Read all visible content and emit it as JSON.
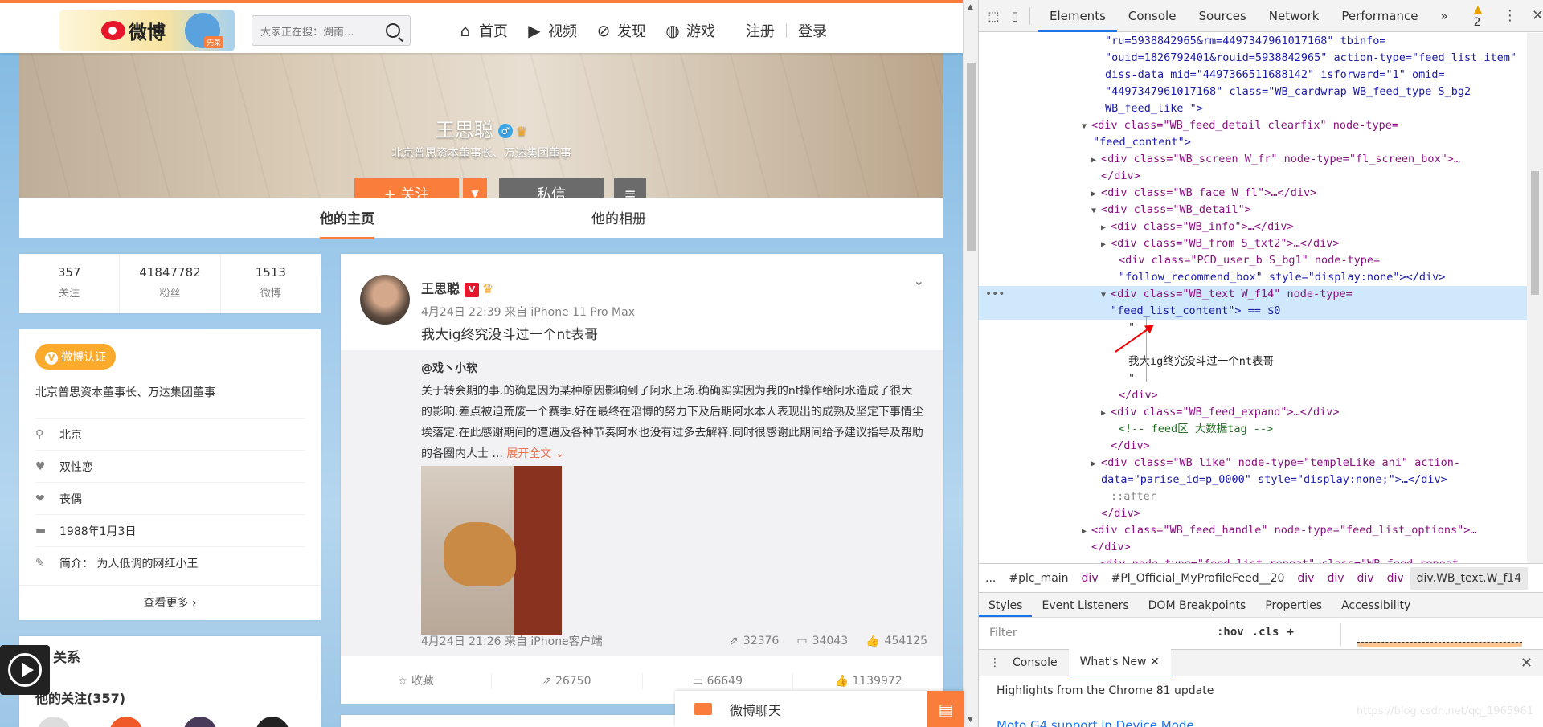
{
  "header": {
    "logo_text": "微博",
    "logo_badge": "先菜",
    "search_placeholder": "大家正在搜：湖南...",
    "nav": [
      {
        "icon": "home-icon",
        "label": "首页"
      },
      {
        "icon": "video-icon",
        "label": "视频"
      },
      {
        "icon": "compass-icon",
        "label": "发现"
      },
      {
        "icon": "gamepad-icon",
        "label": "游戏"
      }
    ],
    "register": "注册",
    "login": "登录"
  },
  "profile": {
    "name": "王思聪",
    "gender_symbol": "♂",
    "description": "北京普思资本董事长、万达集团董事",
    "follow_label": "+ 关注",
    "dropdown_symbol": "▼",
    "message_label": "私信",
    "more_symbol": "≡",
    "tabs": [
      "他的主页",
      "他的相册"
    ]
  },
  "stats": [
    {
      "value": "357",
      "label": "关注"
    },
    {
      "value": "41847782",
      "label": "粉丝"
    },
    {
      "value": "1513",
      "label": "微博"
    }
  ],
  "info": {
    "badge_mark": "V",
    "badge": "微博认证",
    "cert_desc": "北京普思资本董事长、万达集团董事",
    "rows": [
      {
        "icon": "location-icon",
        "glyph": "⚲",
        "text": "北京"
      },
      {
        "icon": "heart-icon",
        "glyph": "♥",
        "text": "双性恋"
      },
      {
        "icon": "hearts-icon",
        "glyph": "❤",
        "text": "丧偶"
      },
      {
        "icon": "cake-icon",
        "glyph": "▬",
        "text": "1988年1月3日"
      },
      {
        "icon": "edit-icon",
        "glyph": "✎",
        "text": "简介：   为人低调的网红小王"
      }
    ],
    "see_more": "查看更多 ›"
  },
  "relations": {
    "title": "关系",
    "following_title": "他的关注(357)"
  },
  "feed": {
    "author": "王思聪",
    "verified_mark": "V",
    "meta": "4月24日 22:39 来自 iPhone 11 Pro Max",
    "text": "我大ig终究没斗过一个nt表哥",
    "repost": {
      "author": "@戏丶小软",
      "text": "关于转会期的事.的确是因为某种原因影响到了阿水上场.确确实实因为我的nt操作给阿水造成了很大的影响.差点被迫荒废一个赛季.好在最终在滔博的努力下及后期阿水本人表现出的成熟及坚定下事情尘埃落定.在此感谢期间的遭遇及各种节奏阿水也没有过多去解释.同时很感谢此期间给予建议指导及帮助的各圈内人士 ...",
      "expand": "展开全文 ⌄",
      "meta": "4月24日 21:26 来自 iPhone客户端",
      "share": "32376",
      "comment": "34043",
      "like": "454125"
    },
    "actions": [
      {
        "icon": "star-icon",
        "glyph": "☆",
        "label": "收藏"
      },
      {
        "icon": "share-icon",
        "glyph": "⇗",
        "label": "26750"
      },
      {
        "icon": "comment-icon",
        "glyph": "▭",
        "label": "66649"
      },
      {
        "icon": "thumb-icon",
        "glyph": "👍",
        "label": "1139972"
      }
    ]
  },
  "chat": {
    "label": "微博聊天"
  },
  "devtools": {
    "tabs": [
      "Elements",
      "Console",
      "Sources",
      "Network",
      "Performance"
    ],
    "overflow": "»",
    "warnings": "2",
    "crumbs": [
      "...",
      "#plc_main",
      "div",
      "#Pl_Official_MyProfileFeed__20",
      "div",
      "div",
      "div",
      "div"
    ],
    "crumb_selected": "div.WB_text.W_f14",
    "subtabs": [
      "Styles",
      "Event Listeners",
      "DOM Breakpoints",
      "Properties",
      "Accessibility"
    ],
    "filter_placeholder": "Filter",
    "hov": ":hov",
    "cls": ".cls",
    "plus": "+",
    "drawer_tabs": [
      "Console",
      "What's New"
    ],
    "whatsnew_title": "Highlights from the Chrome 81 update",
    "whatsnew_link": "Moto G4 support in Device Mode",
    "code": [
      "\"ru=5938842965&rm=4497347961017168\" tbinfo=",
      "\"ouid=1826792401&rouid=5938842965\" action-type=\"feed_list_item\"",
      "diss-data mid=\"4497366511688142\" isforward=\"1\" omid=",
      "\"4497347961017168\" class=\"WB_cardwrap WB_feed_type S_bg2",
      "WB_feed_like \">",
      "<div class=\"WB_feed_detail clearfix\" node-type=",
      "\"feed_content\">",
      "<div class=\"WB_screen W_fr\" node-type=\"fl_screen_box\">…",
      "</div>",
      "<div class=\"WB_face W_fl\">…</div>",
      "<div class=\"WB_detail\">",
      "<div class=\"WB_info\">…</div>",
      "<div class=\"WB_from S_txt2\">…</div>",
      "<div class=\"PCD_user_b S_bg1\" node-type=",
      "\"follow_recommend_box\" style=\"display:none\"></div>",
      "<div class=\"WB_text W_f14\" node-type=",
      "\"feed_list_content\"> == $0",
      "\"",
      "",
      "我大ig终究没斗过一个nt表哥",
      "\"",
      "</div>",
      "<div class=\"WB_feed_expand\">…</div>",
      "<!-- feed区 大数据tag -->",
      "</div>",
      "<div class=\"WB_like\" node-type=\"templeLike_ani\" action-",
      "data=\"parise_id=p_0000\" style=\"display:none;\">…</div>",
      "::after",
      "</div>",
      "<div class=\"WB_feed_handle\" node-type=\"feed_list_options\">…",
      "</div>",
      "<div node-type=\"feed_list_repeat\" class=\"WB_feed_repeat"
    ]
  },
  "watermark": "https://blog.csdn.net/qq_1965961"
}
